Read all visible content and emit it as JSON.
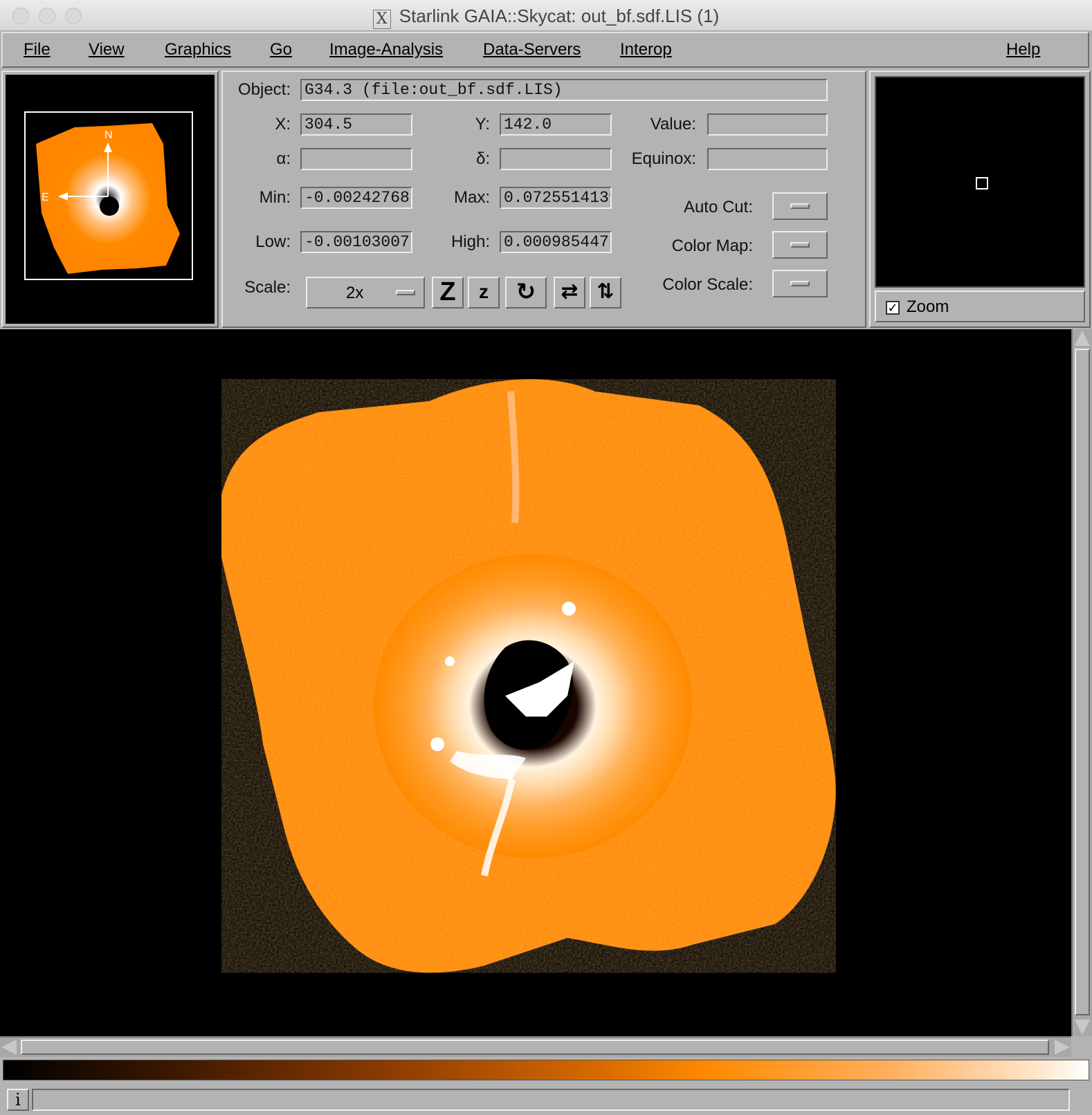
{
  "window": {
    "title": "Starlink GAIA::Skycat: out_bf.sdf.LIS (1)"
  },
  "menubar": {
    "items": [
      {
        "label": "File",
        "key": "F"
      },
      {
        "label": "View",
        "key": "V"
      },
      {
        "label": "Graphics",
        "key": "G"
      },
      {
        "label": "Go",
        "key": "G"
      },
      {
        "label": "Image-Analysis",
        "key": "I"
      },
      {
        "label": "Data-Servers",
        "key": "D"
      },
      {
        "label": "Interop",
        "key": "I"
      },
      {
        "label": "Help",
        "key": "H"
      }
    ]
  },
  "info": {
    "object_label": "Object:",
    "object_value": "G34.3 (file:out_bf.sdf.LIS)",
    "x_label": "X:",
    "x_value": "304.5",
    "y_label": "Y:",
    "y_value": "142.0",
    "value_label": "Value:",
    "value_value": "",
    "alpha_label": "α:",
    "alpha_value": "",
    "delta_label": "δ:",
    "delta_value": "",
    "equinox_label": "Equinox:",
    "equinox_value": "",
    "min_label": "Min:",
    "min_value": "-0.00242768",
    "max_label": "Max:",
    "max_value": "0.0725514139",
    "low_label": "Low:",
    "low_value": "-0.00103007",
    "high_label": "High:",
    "high_value": "0.000985447",
    "autocut_label": "Auto Cut:",
    "colormap_label": "Color Map:",
    "colorscale_label": "Color Scale:",
    "scale_label": "Scale:",
    "scale_value": "2x"
  },
  "tools": {
    "zoom_in": "Z",
    "zoom_out": "z",
    "rotate": "↻",
    "flip_x": "⇄",
    "flip_y": "⇅"
  },
  "magnifier": {
    "zoom_label": "Zoom",
    "zoom_checked": true
  },
  "pan": {
    "north": "N",
    "east": "E"
  },
  "status": {
    "info_button": "i",
    "message": ""
  },
  "colors": {
    "accent": "#ff8a00",
    "panel_bg": "#b3b3b3",
    "image_bg": "#000000"
  },
  "icons": {
    "rotate": "rotate-icon",
    "flip_x": "flip-x-icon",
    "flip_y": "flip-y-icon"
  }
}
